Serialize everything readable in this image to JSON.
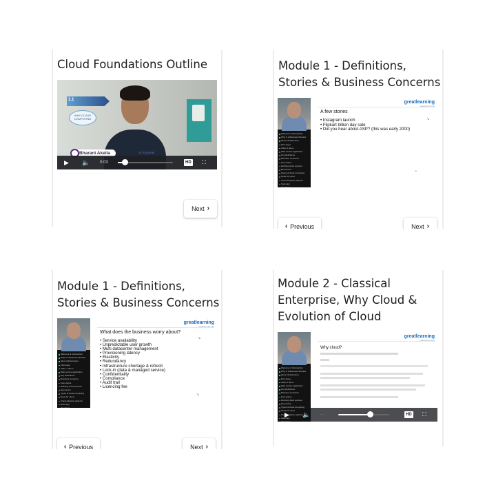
{
  "cards": [
    {
      "title": "Cloud Foundations Outline",
      "video": {
        "tag_number": "1.1",
        "bubble_text": "WHY CLOUD COMPUTING",
        "presenter_name": "Bharani Akella",
        "presenter_sub": "Sr Engineer",
        "time": "0:03",
        "progress": 0.12,
        "quality": "HD"
      },
      "next_label": "Next"
    },
    {
      "title": "Module 1 - Definitions, Stories & Business Concerns",
      "slide": {
        "brand": "greatlearning",
        "brand_sub": "Learning for Life",
        "heading": "A few stories",
        "bullets": [
          "Instagram launch",
          "Flipkart billion day sale",
          "Did you hear about ASP? (this was early 2000)"
        ]
      },
      "previous_label": "Previous",
      "next_label": "Next"
    },
    {
      "title": "Module 1 - Definitions, Stories & Business Concerns",
      "slide": {
        "brand": "greatlearning",
        "brand_sub": "Learning for Life",
        "heading": "What does the business worry about?",
        "bullets": [
          "Service availability",
          "Unpredictable user growth",
          "Multi datacenter management",
          "Provisioning latency",
          "Elasticity",
          "Redundancy",
          "Infrastructure shortage & refresh",
          "Lock-in (data & managed service)",
          "Confidentiality",
          "Compliance",
          "Audit trail",
          "Licencing fee"
        ]
      },
      "previous_label": "Previous",
      "next_label": "Next"
    },
    {
      "title": "Module 2 - Classical Enterprise, Why Cloud & Evolution of Cloud",
      "slide": {
        "brand": "greatlearning",
        "brand_sub": "Learning for Life",
        "heading": "Why cloud?",
        "progress": 0.62,
        "quality": "HD"
      }
    }
  ],
  "sidebar_items": [
    "Welcome & Introduction",
    "Why is a Business Worried",
    "about infrastructure",
    "First steps",
    "Video 1 demo",
    "Web service application",
    "Key Definitions",
    "Business Concerns",
    "Few stories",
    "Defining cloud services",
    "Economics",
    "Types of cloud computing",
    "Need for cloud",
    "Cloud adoption patterns",
    "Summary",
    "Questions"
  ],
  "colors": {
    "brand_blue": "#1669b8",
    "sidebar_dark": "#121212",
    "done_green": "#3ccf6a"
  }
}
